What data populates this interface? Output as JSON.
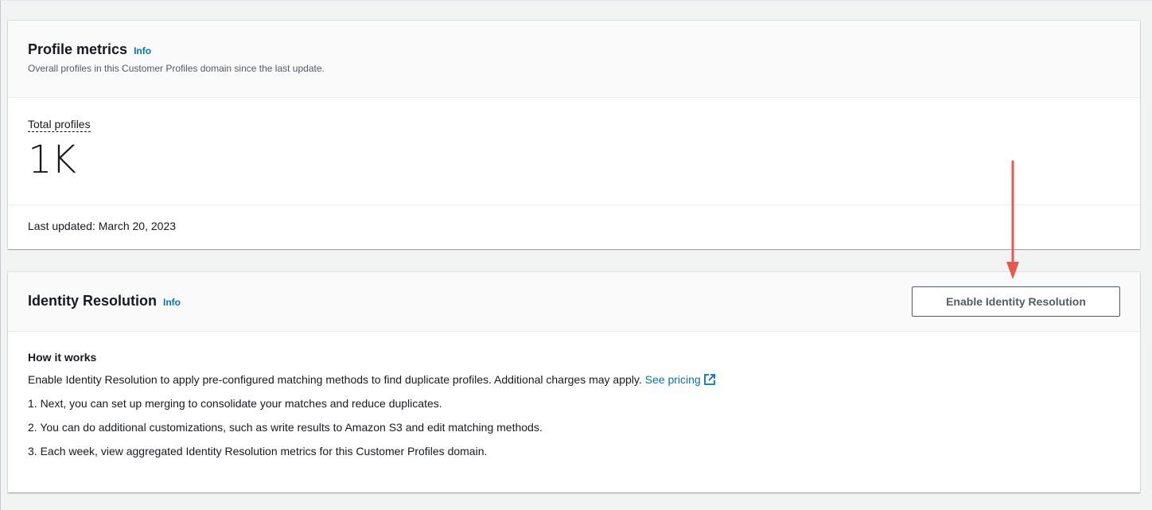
{
  "profile_metrics": {
    "title": "Profile metrics",
    "info": "Info",
    "subtitle": "Overall profiles in this Customer Profiles domain since the last update.",
    "metric_label": "Total profiles",
    "metric_value": "1K",
    "last_updated": "Last updated: March 20, 2023"
  },
  "identity_resolution": {
    "title": "Identity Resolution",
    "info": "Info",
    "button_label": "Enable Identity Resolution",
    "how_title": "How it works",
    "description": "Enable Identity Resolution to apply pre-configured matching methods to find duplicate profiles. Additional charges may apply.",
    "pricing_link": "See pricing",
    "steps": [
      "1. Next, you can set up merging to consolidate your matches and reduce duplicates.",
      "2. You can do additional customizations, such as write results to Amazon S3 and edit matching methods.",
      "3. Each week, view aggregated Identity Resolution metrics for this Customer Profiles domain."
    ]
  },
  "colors": {
    "link": "#0073bb",
    "annotation_arrow": "#e8584f",
    "text": "#16191f"
  },
  "icons": {
    "external_link": "external-link-icon",
    "annotation": "arrow-down-icon"
  }
}
